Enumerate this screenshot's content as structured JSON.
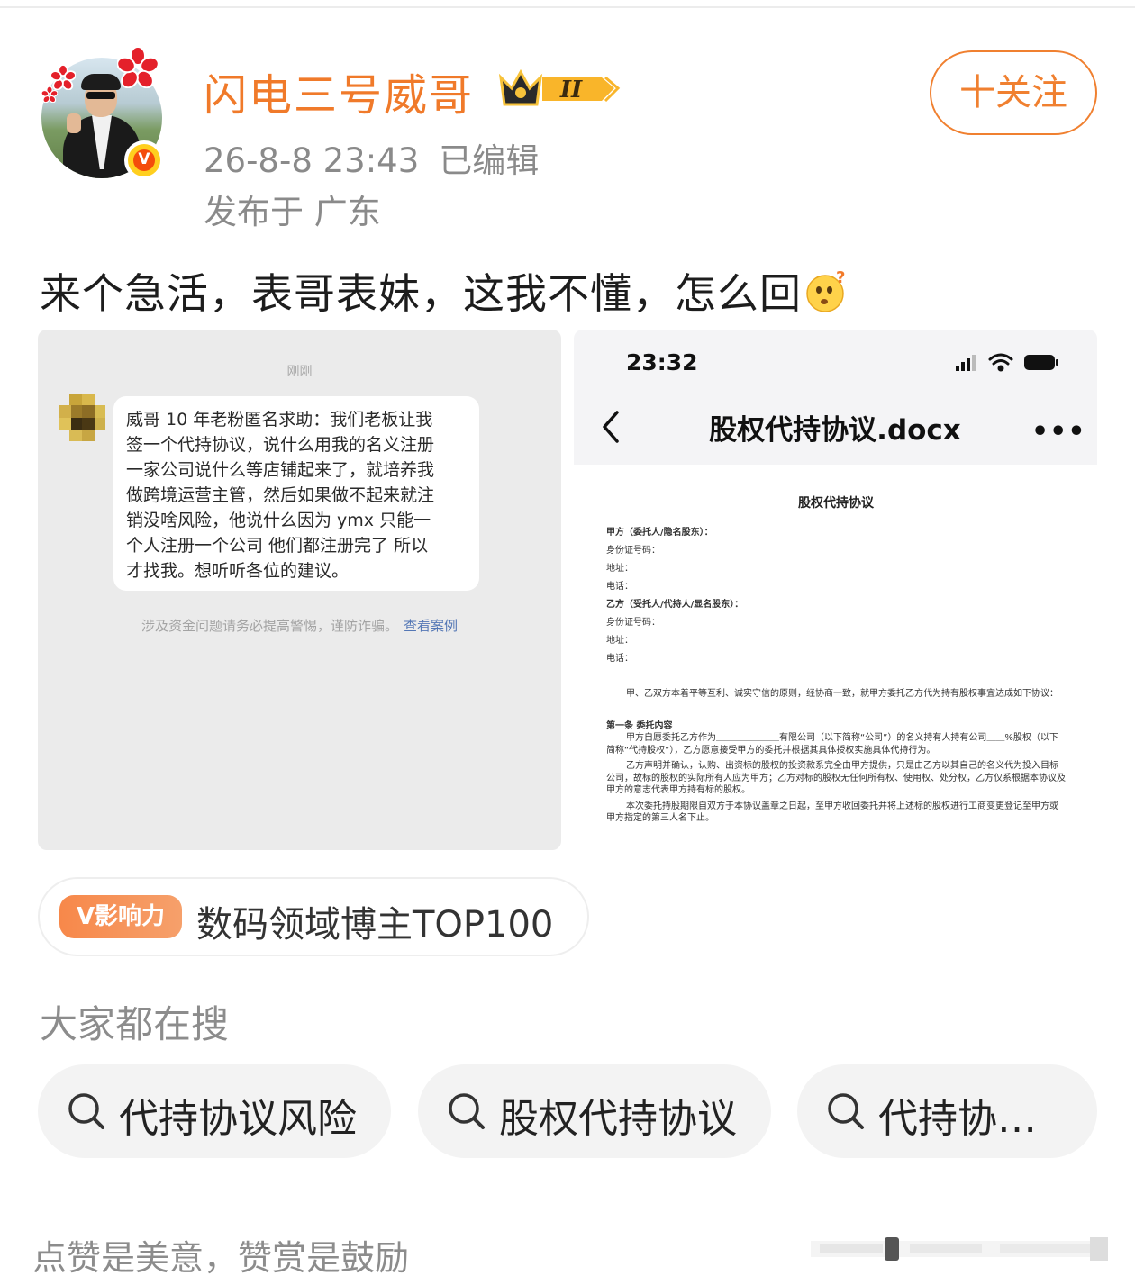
{
  "author": {
    "name": "闪电三号威哥",
    "verified_mark": "V",
    "vip_level": "II",
    "timestamp": "26-8-8 23:43",
    "edited_label": "已编辑",
    "location": "发布于 广东",
    "follow_label": "十关注"
  },
  "post": {
    "text": "来个急活，表哥表妹，这我不懂，怎么回",
    "trailing_emoji": "thinking-face-icon"
  },
  "images": {
    "chat": {
      "time": "刚刚",
      "message_lines": [
        "威哥 10 年老粉匿名求助：我们老板让我",
        "签一个代持协议，说什么用我的名义注册",
        "一家公司说什么等店铺起来了，就培养我",
        "做跨境运营主管，然后如果做不起来就注",
        "销没啥风险，他说什么因为 ymx 只能一",
        "个人注册一个公司 他们都注册完了 所以",
        "才找我。想听听各位的建议。"
      ],
      "warning": "涉及资金问题请务必提高警惕，谨防诈骗。",
      "warning_link": "查看案例"
    },
    "document": {
      "status_time": "23:32",
      "file_title": "股权代持协议.docx",
      "more_label": "•••",
      "heading": "股权代持协议",
      "party_a": "甲方（委托人/隐名股东）：",
      "id_label_a": "身份证号码：",
      "address_label_a": "地址：",
      "phone_label_a": "电话：",
      "party_b": "乙方（受托人/代持人/显名股东）：",
      "id_label_b": "身份证号码：",
      "address_label_b": "地址：",
      "phone_label_b": "电话：",
      "intro": "甲、乙双方本着平等互利、诚实守信的原则，经协商一致，就甲方委托乙方代为持有股权事宜达成如下协议：",
      "section_title": "第一条 委托内容",
      "clause_1": "甲方自愿委托乙方作为＿＿＿＿＿＿＿有限公司（以下简称“公司”）的名义持有人持有公司＿＿%股权（以下简称“代持股权”），乙方愿意接受甲方的委托并根据其具体授权实施具体代持行为。",
      "clause_2": "乙方声明并确认，认购、出资标的股权的投资款系完全由甲方提供，只是由乙方以其自己的名义代为投入目标公司，故标的股权的实际所有人应为甲方；乙方对标的股权无任何所有权、使用权、处分权，乙方仅系根据本协议及甲方的意志代表甲方持有标的股权。",
      "clause_3": "本次委托持股期限自双方于本协议盖章之日起，至甲方收回委托并将上述标的股权进行工商变更登记至甲方或甲方指定的第三人名下止。"
    }
  },
  "influence": {
    "tag": "V影响力",
    "text": "数码领域博主TOP100"
  },
  "search": {
    "heading": "大家都在搜",
    "chips": [
      "代持协议风险",
      "股权代持协议",
      "代持协…"
    ]
  },
  "footer": {
    "text": "点赞是美意，赞赏是鼓励"
  },
  "colors": {
    "brand_orange": "#f07a2a",
    "link_blue": "#5477b5",
    "muted_gray": "#8a8a8a"
  }
}
